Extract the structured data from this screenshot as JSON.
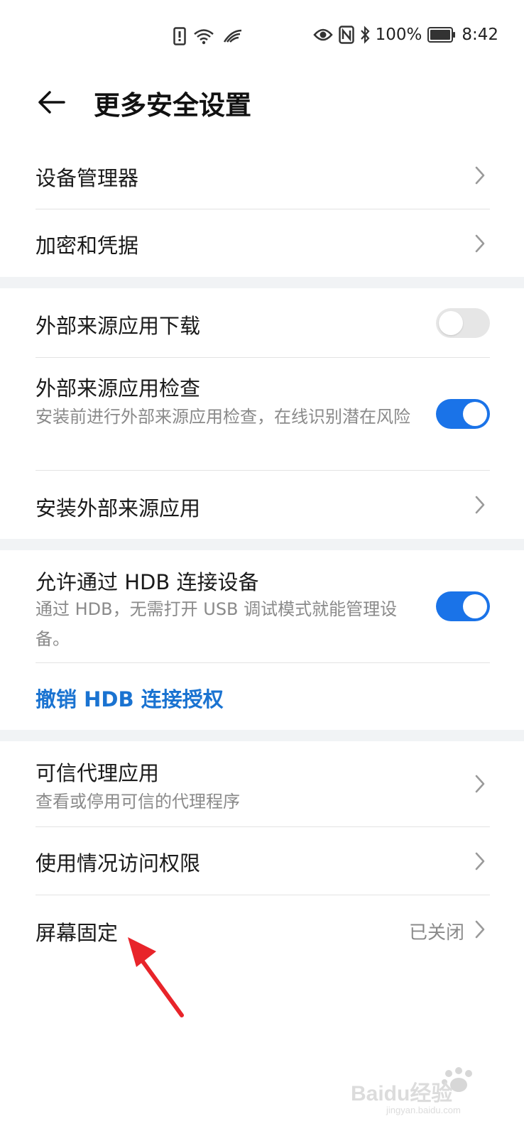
{
  "status_bar": {
    "battery": "100%",
    "time": "8:42"
  },
  "header": {
    "title": "更多安全设置"
  },
  "items": {
    "device_manager": {
      "title": "设备管理器"
    },
    "encryption": {
      "title": "加密和凭据"
    },
    "external_download": {
      "title": "外部来源应用下载",
      "toggle": false
    },
    "external_check": {
      "title": "外部来源应用检查",
      "subtitle": "安装前进行外部来源应用检查，在线识别潜在风险",
      "toggle": true
    },
    "install_external": {
      "title": "安装外部来源应用"
    },
    "hdb": {
      "title": "允许通过 HDB 连接设备",
      "subtitle": "通过 HDB，无需打开 USB 调试模式就能管理设备。",
      "toggle": true
    },
    "revoke_hdb": {
      "title": "撤销 HDB 连接授权"
    },
    "trust_agents": {
      "title": "可信代理应用",
      "subtitle": "查看或停用可信的代理程序"
    },
    "usage_access": {
      "title": "使用情况访问权限"
    },
    "screen_pinning": {
      "title": "屏幕固定",
      "value": "已关闭"
    }
  },
  "watermark": {
    "brand": "Baidu经验",
    "url": "jingyan.baidu.com"
  },
  "colors": {
    "accent": "#1a73e8",
    "link": "#1a73d1",
    "annotation_arrow": "#e8242a",
    "section_gap": "#f1f3f5"
  }
}
